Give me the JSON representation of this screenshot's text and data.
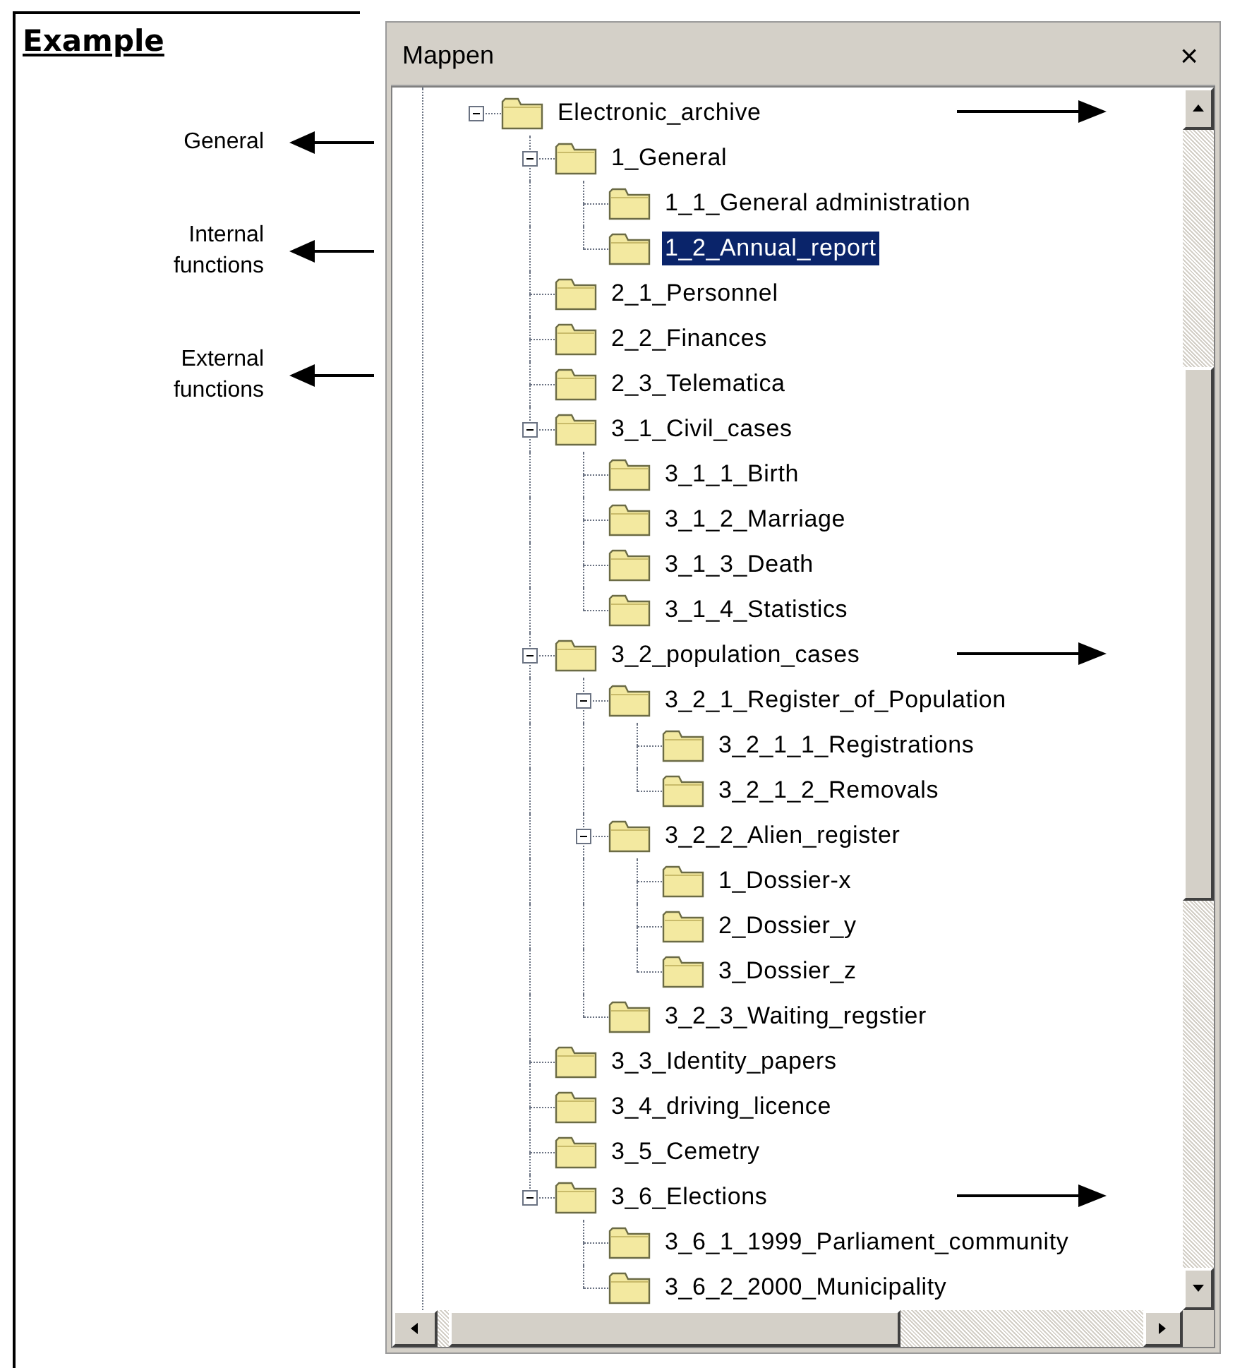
{
  "doc": {
    "heading": "Example",
    "annotations": [
      {
        "label": "General"
      },
      {
        "label": "Internal functions"
      },
      {
        "label": "External functions"
      }
    ]
  },
  "window": {
    "title": "Mappen",
    "close": "×"
  },
  "tree": [
    {
      "label": "Electronic_archive",
      "expanded": true,
      "selected": false,
      "arrow": true,
      "children": [
        {
          "label": "1_General",
          "expanded": true,
          "selected": false,
          "arrow": false,
          "children": [
            {
              "label": "1_1_General administration",
              "selected": false,
              "arrow": false
            },
            {
              "label": "1_2_Annual_report",
              "selected": true,
              "arrow": false
            }
          ]
        },
        {
          "label": "2_1_Personnel",
          "selected": false,
          "arrow": false
        },
        {
          "label": "2_2_Finances",
          "selected": false,
          "arrow": false
        },
        {
          "label": "2_3_Telematica",
          "selected": false,
          "arrow": false
        },
        {
          "label": "3_1_Civil_cases",
          "expanded": true,
          "selected": false,
          "arrow": false,
          "children": [
            {
              "label": "3_1_1_Birth",
              "selected": false,
              "arrow": false
            },
            {
              "label": "3_1_2_Marriage",
              "selected": false,
              "arrow": false
            },
            {
              "label": "3_1_3_Death",
              "selected": false,
              "arrow": false
            },
            {
              "label": "3_1_4_Statistics",
              "selected": false,
              "arrow": false
            }
          ]
        },
        {
          "label": "3_2_population_cases",
          "expanded": true,
          "selected": false,
          "arrow": true,
          "children": [
            {
              "label": "3_2_1_Register_of_Population",
              "expanded": true,
              "selected": false,
              "arrow": false,
              "children": [
                {
                  "label": "3_2_1_1_Registrations",
                  "selected": false,
                  "arrow": false
                },
                {
                  "label": "3_2_1_2_Removals",
                  "selected": false,
                  "arrow": false
                }
              ]
            },
            {
              "label": "3_2_2_Alien_register",
              "expanded": true,
              "selected": false,
              "arrow": false,
              "children": [
                {
                  "label": "1_Dossier-x",
                  "selected": false,
                  "arrow": false
                },
                {
                  "label": "2_Dossier_y",
                  "selected": false,
                  "arrow": false
                },
                {
                  "label": "3_Dossier_z",
                  "selected": false,
                  "arrow": false
                }
              ]
            },
            {
              "label": "3_2_3_Waiting_regstier",
              "selected": false,
              "arrow": false
            }
          ]
        },
        {
          "label": "3_3_Identity_papers",
          "selected": false,
          "arrow": false
        },
        {
          "label": "3_4_driving_licence",
          "selected": false,
          "arrow": false
        },
        {
          "label": "3_5_Cemetry",
          "selected": false,
          "arrow": false
        },
        {
          "label": "3_6_Elections",
          "expanded": true,
          "selected": false,
          "arrow": true,
          "children": [
            {
              "label": "3_6_1_1999_Parliament_community",
              "selected": false,
              "arrow": false
            },
            {
              "label": "3_6_2_2000_Municipality",
              "selected": false,
              "arrow": false
            }
          ]
        }
      ]
    }
  ]
}
